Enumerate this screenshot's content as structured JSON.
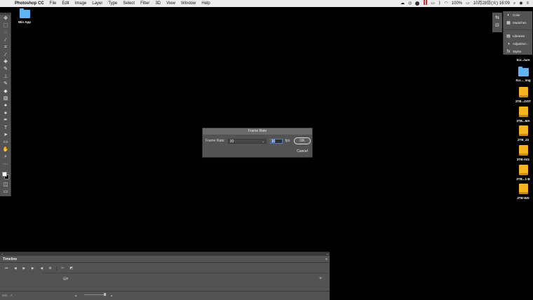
{
  "menubar": {
    "app_name": "Photoshop CC",
    "items": [
      "File",
      "Edit",
      "Image",
      "Layer",
      "Type",
      "Select",
      "Filter",
      "3D",
      "View",
      "Window",
      "Help"
    ],
    "battery": "100%",
    "clock": "10月28日(火)  16:09"
  },
  "desktop": {
    "left_icons": [
      {
        "label": "Win App",
        "icon": "folder-icon"
      }
    ],
    "right_icons": [
      {
        "label": "Scr...ture",
        "icon": "file-icon"
      },
      {
        "label": "Scr..._img",
        "icon": "folder-icon"
      },
      {
        "label": "3TB...GOT",
        "icon": "drive-icon"
      },
      {
        "label": "3TB...MA",
        "icon": "drive-icon"
      },
      {
        "label": "2TB_23",
        "icon": "drive-icon"
      },
      {
        "label": "3TB-A01",
        "icon": "drive-icon"
      },
      {
        "label": "3TB...1-B",
        "icon": "drive-icon"
      },
      {
        "label": "4TB-WD",
        "icon": "drive-icon"
      }
    ]
  },
  "right_panel": {
    "items": [
      {
        "label": "Color",
        "icon": "color-icon"
      },
      {
        "label": "Swatches",
        "icon": "swatches-icon"
      },
      {
        "label": "Libraries",
        "icon": "libraries-icon"
      },
      {
        "label": "Adjustme...",
        "icon": "adjustments-icon"
      },
      {
        "label": "Styles",
        "icon": "styles-icon"
      }
    ]
  },
  "dialog": {
    "title": "Frame Rate",
    "label": "Frame Rate:",
    "select_value": "30",
    "number_value": "30",
    "unit": "fps",
    "ok": "OK",
    "cancel": "Cancel"
  },
  "timeline": {
    "tab": "Timeline",
    "footer_left": "000"
  }
}
